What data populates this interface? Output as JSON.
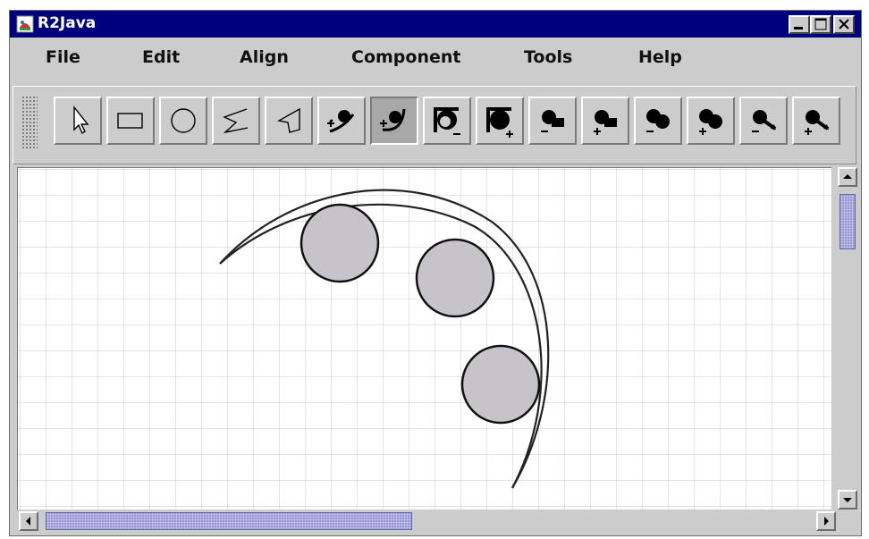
{
  "window": {
    "title": "R2Java",
    "controls": [
      "minimize",
      "maximize",
      "close"
    ]
  },
  "menubar": {
    "items": [
      "File",
      "Edit",
      "Align",
      "Component",
      "Tools",
      "Help"
    ]
  },
  "toolbar": {
    "tools": [
      {
        "name": "select-pointer-icon",
        "pressed": false
      },
      {
        "name": "rectangle-icon",
        "pressed": false
      },
      {
        "name": "circle-icon",
        "pressed": false
      },
      {
        "name": "open-polyline-icon",
        "pressed": false
      },
      {
        "name": "polygon-icon",
        "pressed": false
      },
      {
        "name": "sweep-ball-arc-icon",
        "pressed": false
      },
      {
        "name": "sweep-ball-curve-icon",
        "pressed": true
      },
      {
        "name": "ball-cut-minus-icon",
        "pressed": false
      },
      {
        "name": "ball-cut-plus-icon",
        "pressed": false
      },
      {
        "name": "ball-square-minus-icon",
        "pressed": false
      },
      {
        "name": "ball-square-plus-icon",
        "pressed": false
      },
      {
        "name": "double-ball-minus-icon",
        "pressed": false
      },
      {
        "name": "double-ball-plus-icon",
        "pressed": false
      },
      {
        "name": "arrow-ball-minus-icon",
        "pressed": false
      },
      {
        "name": "arrow-ball-plus-icon",
        "pressed": false
      }
    ]
  },
  "canvas": {
    "grid": true,
    "shape_fill": "#c6c4c8",
    "shape_stroke": "#000000",
    "grid_color": "#c8c8c8"
  },
  "scrollbars": {
    "vertical_position": 0.1,
    "horizontal_position": 0.0
  }
}
